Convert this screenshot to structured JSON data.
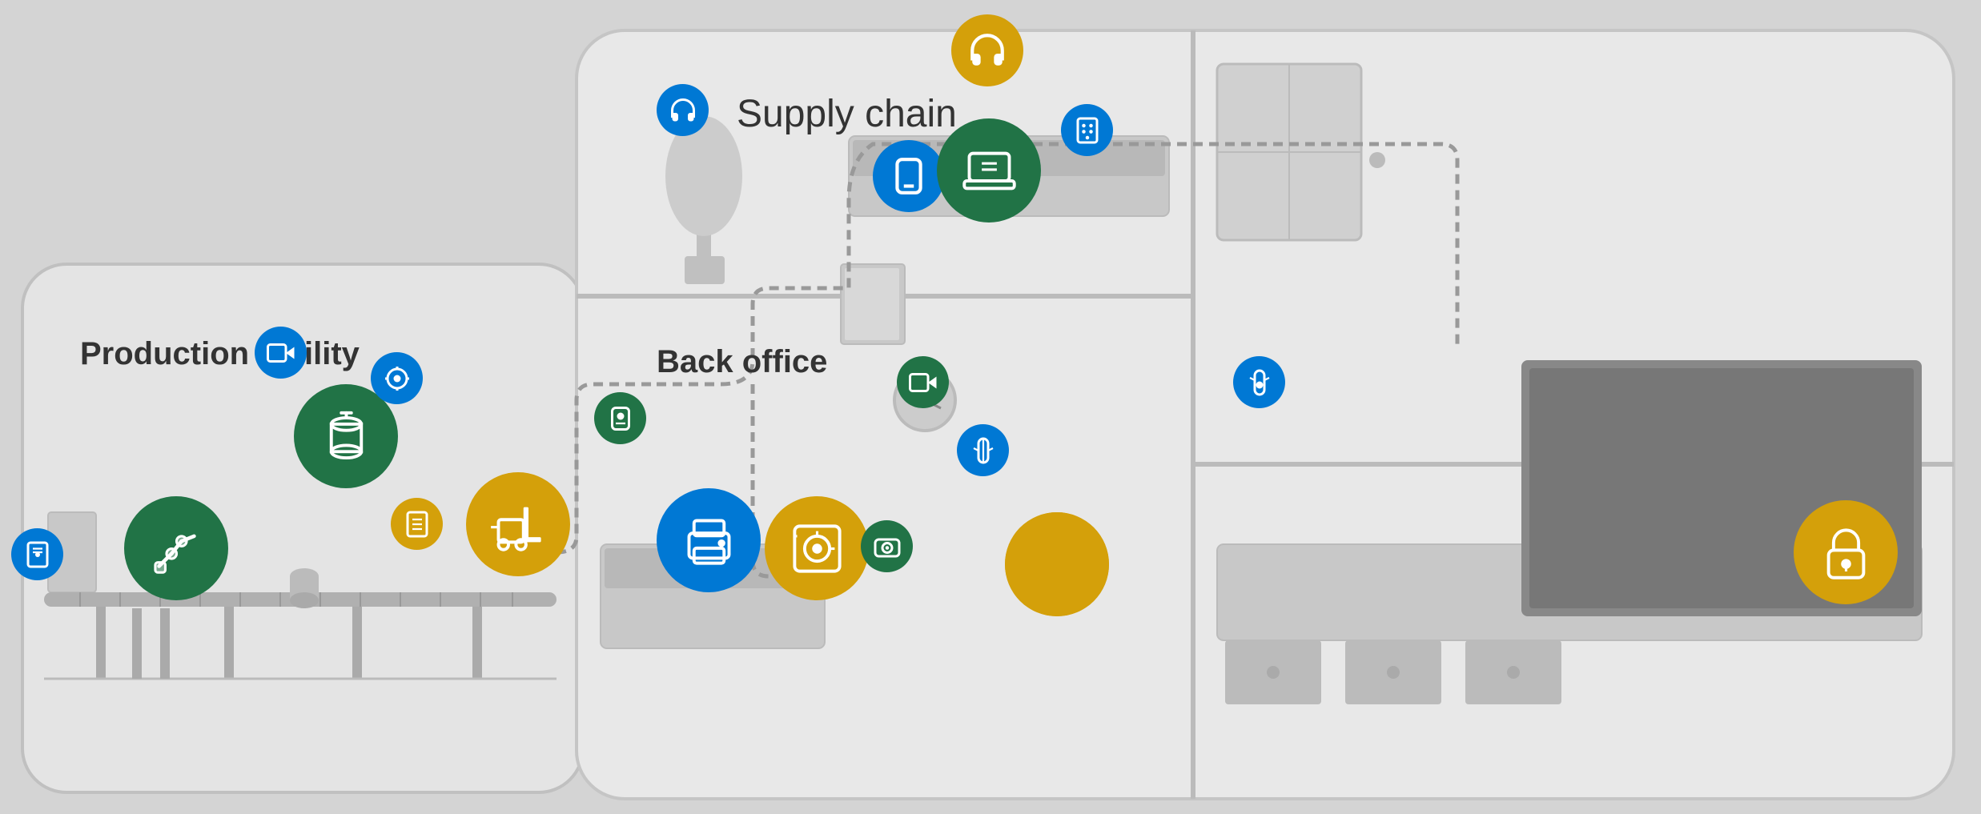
{
  "sections": {
    "production": {
      "label": "Production facility"
    },
    "back_office": {
      "label": "Back office"
    },
    "supply_chain": {
      "label": "Supply chain"
    }
  },
  "icons": {
    "robot_arm": "🦾",
    "tank": "🏭",
    "forklift": "🚜",
    "printer": "🖨",
    "safe": "🔐",
    "camera": "📷",
    "laptop": "💻",
    "phone": "📱",
    "headset": "🎧",
    "lock": "🔒",
    "keypad": "🔢",
    "badge": "🪪",
    "controller": "🎮",
    "sensor": "📡"
  },
  "colors": {
    "green": "#217346",
    "blue": "#0078d4",
    "yellow": "#d4a00a",
    "bg": "#d8d8d8",
    "building": "#e8e8e8"
  }
}
